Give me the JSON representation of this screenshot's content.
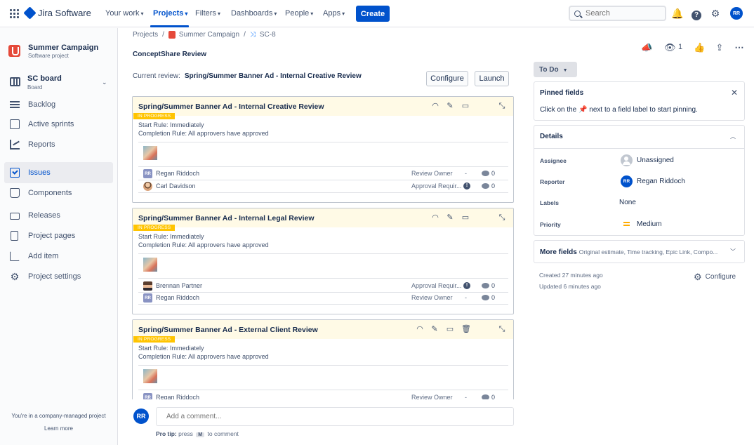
{
  "topnav": {
    "product": "Jira Software",
    "items": [
      {
        "label": "Your work"
      },
      {
        "label": "Projects"
      },
      {
        "label": "Filters"
      },
      {
        "label": "Dashboards"
      },
      {
        "label": "People"
      },
      {
        "label": "Apps"
      }
    ],
    "create_label": "Create",
    "search_placeholder": "Search",
    "user_initials": "RR",
    "accent": "#0052cc"
  },
  "sidebar": {
    "project_name": "Summer Campaign",
    "project_type": "Software project",
    "board_name": "SC board",
    "board_type": "Board",
    "items": [
      {
        "label": "Backlog",
        "icon": "backlog-icon"
      },
      {
        "label": "Active sprints",
        "icon": "sprint-board-icon"
      },
      {
        "label": "Reports",
        "icon": "reports-icon"
      },
      {
        "label": "Issues",
        "icon": "issues-icon",
        "selected": true
      },
      {
        "label": "Components",
        "icon": "components-icon"
      },
      {
        "label": "Releases",
        "icon": "releases-icon"
      },
      {
        "label": "Project pages",
        "icon": "pages-icon"
      },
      {
        "label": "Add item",
        "icon": "add-item-icon"
      },
      {
        "label": "Project settings",
        "icon": "gear-icon"
      }
    ],
    "footer_text": "You're in a company-managed project",
    "footer_link": "Learn more"
  },
  "breadcrumb": {
    "root": "Projects",
    "project": "Summer Campaign",
    "issue": "SC-8"
  },
  "review_panel": {
    "title": "ConceptShare Review",
    "current_label": "Current review:",
    "current_value": "Spring/Summer Banner Ad - Internal Creative Review",
    "configure_label": "Configure",
    "launch_label": "Launch",
    "cards": [
      {
        "title": "Spring/Summer Banner Ad - Internal Creative Review",
        "status": "IN PROGRESS",
        "start_rule": "Start Rule: Immediately",
        "completion_rule": "Completion Rule: All approvers have approved",
        "participants": [
          {
            "name": "Regan Riddoch",
            "initials": "RR",
            "role": "Review Owner",
            "state": "-",
            "comments": "0"
          },
          {
            "name": "Carl Davidson",
            "initials": "",
            "role": "Approval Requir...",
            "state": "!",
            "comments": "0"
          }
        ]
      },
      {
        "title": "Spring/Summer Banner Ad - Internal Legal Review",
        "status": "IN PROGRESS",
        "start_rule": "Start Rule: Immediately",
        "completion_rule": "Completion Rule: All approvers have approved",
        "participants": [
          {
            "name": "Brennan Partner",
            "initials": "",
            "role": "Approval Requir...",
            "state": "!",
            "comments": "0"
          },
          {
            "name": "Regan Riddoch",
            "initials": "RR",
            "role": "Review Owner",
            "state": "-",
            "comments": "0"
          }
        ]
      },
      {
        "title": "Spring/Summer Banner Ad - External Client Review",
        "status": "IN PROGRESS",
        "start_rule": "Start Rule: Immediately",
        "completion_rule": "Completion Rule: All approvers have approved",
        "participants": [
          {
            "name": "Regan Riddoch",
            "initials": "RR",
            "role": "Review Owner",
            "state": "-",
            "comments": "0"
          }
        ]
      }
    ],
    "status_color": "#ffc400"
  },
  "comment": {
    "avatar_initials": "RR",
    "placeholder": "Add a comment...",
    "protip_bold": "Pro tip:",
    "protip_press": "press",
    "protip_key": "M",
    "protip_rest": "to comment"
  },
  "issue_side": {
    "watch_count": "1",
    "status": "To Do",
    "pinned_title": "Pinned fields",
    "pinned_text_a": "Click on the",
    "pinned_text_b": "next to a field label to start pinning.",
    "details_title": "Details",
    "fields": {
      "assignee_label": "Assignee",
      "assignee_value": "Unassigned",
      "reporter_label": "Reporter",
      "reporter_value": "Regan Riddoch",
      "reporter_initials": "RR",
      "labels_label": "Labels",
      "labels_value": "None",
      "priority_label": "Priority",
      "priority_value": "Medium"
    },
    "more_fields_title": "More fields",
    "more_fields_hint": "Original estimate, Time tracking, Epic Link, Compo...",
    "created": "Created 27 minutes ago",
    "updated": "Updated 6 minutes ago",
    "configure_label": "Configure"
  }
}
